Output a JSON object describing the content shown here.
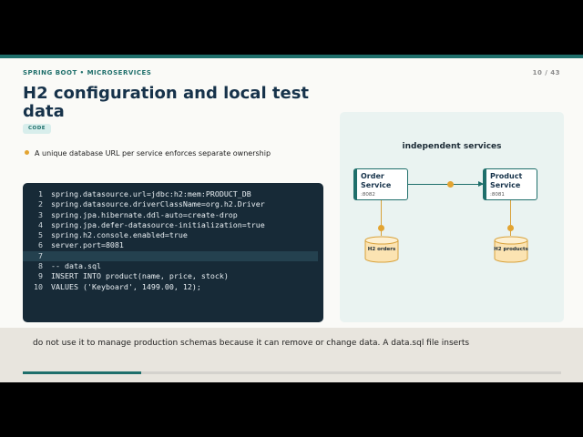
{
  "header": {
    "kicker": "SPRING BOOT • MICROSERVICES",
    "page_indicator": "10 / 43"
  },
  "slide": {
    "title": "H2 configuration and local test data",
    "tag": "CODE",
    "bullet": "A unique database URL per service enforces separate ownership"
  },
  "code": {
    "lines": [
      {
        "n": "1",
        "text": "spring.datasource.url=jdbc:h2:mem:PRODUCT_DB"
      },
      {
        "n": "2",
        "text": "spring.datasource.driverClassName=org.h2.Driver"
      },
      {
        "n": "3",
        "text": "spring.jpa.hibernate.ddl-auto=create-drop"
      },
      {
        "n": "4",
        "text": "spring.jpa.defer-datasource-initialization=true"
      },
      {
        "n": "5",
        "text": "spring.h2.console.enabled=true"
      },
      {
        "n": "6",
        "text": "server.port=8081"
      },
      {
        "n": "7",
        "text": ""
      },
      {
        "n": "8",
        "text": "-- data.sql"
      },
      {
        "n": "9",
        "text": "INSERT INTO product(name, price, stock)"
      },
      {
        "n": "10",
        "text": "VALUES ('Keyboard', 1499.00, 12);"
      }
    ],
    "highlighted_line": 7
  },
  "diagram": {
    "title": "independent services",
    "services": [
      {
        "name": "Order Service",
        "port": ":8082",
        "db": "H2 orders"
      },
      {
        "name": "Product Service",
        "port": ":8081",
        "db": "H2 products"
      }
    ],
    "colors": {
      "accent": "#1f6f6b",
      "db": "#e3a432"
    }
  },
  "caption": {
    "text": "do not use it to manage production schemas because it can remove or change data. A data.sql file inserts"
  },
  "progress": {
    "fraction": 0.22
  }
}
